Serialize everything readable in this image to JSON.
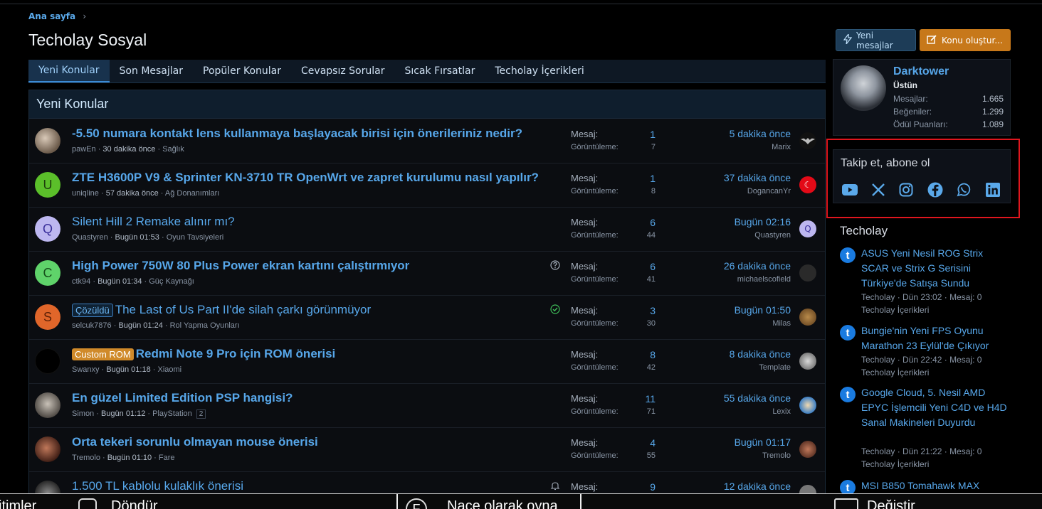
{
  "breadcrumb": {
    "home": "Ana sayfa",
    "sep": "›"
  },
  "page_title": "Techolay Sosyal",
  "actions": {
    "new_messages": "Yeni mesajlar",
    "create_thread": "Konu oluştur..."
  },
  "tabs": [
    "Yeni Konular",
    "Son Mesajlar",
    "Popüler Konular",
    "Cevapsız Sorular",
    "Sıcak Fırsatlar",
    "Techolay İçerikleri"
  ],
  "panel_title": "Yeni Konular",
  "labels": {
    "replies": "Mesaj:",
    "views": "Görüntüleme:"
  },
  "threads": [
    {
      "title": "-5.50 numara kontakt lens kullanmaya başlayacak birisi için önerileriniz nedir?",
      "author": "pawEn",
      "time": "30 dakika önce",
      "forum": "Sağlık",
      "replies": "1",
      "views": "7",
      "last_time": "5 dakika önce",
      "last_user": "Marix",
      "avatar_letter": "",
      "avatar_color": "#6b6b6b",
      "mini_letter": "",
      "mini_color": "#222"
    },
    {
      "title": "ZTE H3600P V9 & Sprinter KN-3710 TR OpenWrt ve zapret kurulumu nasıl yapılır?",
      "author": "uniqline",
      "time": "57 dakika önce",
      "forum": "Ağ Donanımları",
      "replies": "1",
      "views": "8",
      "last_time": "37 dakika önce",
      "last_user": "DogancanYr",
      "avatar_letter": "U",
      "avatar_color": "#5bbf2a",
      "mini_letter": "☾",
      "mini_color": "#e30a17"
    },
    {
      "title": "Silent Hill 2 Remake alınır mı?",
      "author": "Quastyren",
      "time": "Bugün 01:53",
      "forum": "Oyun Tavsiyeleri",
      "replies": "6",
      "views": "44",
      "last_time": "Bugün 02:16",
      "last_user": "Quastyren",
      "avatar_letter": "Q",
      "avatar_color": "#bdb7f0",
      "mini_letter": "Q",
      "mini_color": "#bdb7f0"
    },
    {
      "title": "High Power 750W 80 Plus Power ekran kartını çalıştırmıyor",
      "author": "ctk94",
      "time": "Bugün 01:34",
      "forum": "Güç Kaynağı",
      "replies": "6",
      "views": "41",
      "last_time": "26 dakika önce",
      "last_user": "michaelscofield",
      "avatar_letter": "C",
      "avatar_color": "#5fd36a",
      "mini_letter": "",
      "mini_color": "#333"
    },
    {
      "title": "The Last of Us Part II'de silah çarkı görünmüyor",
      "prefix": "Çözüldü",
      "author": "selcuk7876",
      "time": "Bugün 01:24",
      "forum": "Rol Yapma Oyunları",
      "replies": "3",
      "views": "30",
      "last_time": "Bugün 01:50",
      "last_user": "Milas",
      "avatar_letter": "S",
      "avatar_color": "#e0662a",
      "mini_letter": "",
      "mini_color": "#8a5a2a"
    },
    {
      "title": "Redmi Note 9 Pro için ROM önerisi",
      "prefix": "Custom ROM",
      "author": "Swanxy",
      "time": "Bugün 01:18",
      "forum": "Xiaomi",
      "replies": "8",
      "views": "42",
      "last_time": "8 dakika önce",
      "last_user": "Template",
      "avatar_letter": "",
      "avatar_color": "#000",
      "mini_letter": "",
      "mini_color": "#c9c9c9"
    },
    {
      "title": "En güzel Limited Edition PSP hangisi?",
      "author": "Simon",
      "time": "Bugün 01:12",
      "forum": "PlayStation",
      "pages": "2",
      "replies": "11",
      "views": "71",
      "last_time": "55 dakika önce",
      "last_user": "Lexix",
      "avatar_letter": "",
      "avatar_color": "#8c8c8c",
      "mini_letter": "",
      "mini_color": "#3c7fc4"
    },
    {
      "title": "Orta tekeri sorunlu olmayan mouse önerisi",
      "author": "Tremolo",
      "time": "Bugün 01:10",
      "forum": "Fare",
      "replies": "4",
      "views": "55",
      "last_time": "Bugün 01:17",
      "last_user": "Tremolo",
      "avatar_letter": "",
      "avatar_color": "#7a3b2a",
      "mini_letter": "",
      "mini_color": "#7a3b2a"
    },
    {
      "title": "1.500 TL kablolu kulaklık önerisi",
      "author": "",
      "time": "",
      "forum": "",
      "replies": "9",
      "views": "",
      "last_time": "12 dakika önce",
      "last_user": "",
      "avatar_letter": "",
      "avatar_color": "#444",
      "mini_letter": "",
      "mini_color": "#555"
    }
  ],
  "sidebar": {
    "user": {
      "name": "Darktower",
      "rank": "Üstün",
      "stats": [
        {
          "label": "Mesajlar:",
          "value": "1.665"
        },
        {
          "label": "Beğeniler:",
          "value": "1.299"
        },
        {
          "label": "Ödül Puanları:",
          "value": "1.089"
        }
      ]
    },
    "follow_title": "Takip et, abone ol",
    "social_icons": [
      "youtube-icon",
      "x-icon",
      "instagram-icon",
      "facebook-icon",
      "whatsapp-icon",
      "linkedin-icon"
    ],
    "section_title": "Techolay",
    "news": [
      {
        "title": "ASUS Yeni Nesil ROG Strix SCAR ve Strix G Serisini Türkiye'de Satışa Sundu",
        "meta1": "Techolay · Dün 23:02 · Mesaj: 0",
        "meta2": "Techolay İçerikleri"
      },
      {
        "title": "Bungie'nin Yeni FPS Oyunu Marathon 23 Eylül'de Çıkıyor",
        "meta1": "Techolay · Dün 22:42 · Mesaj: 0",
        "meta2": "Techolay İçerikleri"
      },
      {
        "title": "Google Cloud, 5. Nesil AMD EPYC İşlemcili Yeni C4D ve H4D Sanal Makineleri Duyurdu",
        "meta1": "Techolay · Dün 21:22 · Mesaj: 0",
        "meta2": "Techolay İçerikleri"
      },
      {
        "title": "MSI B850 Tomahawk MAX",
        "meta1": "",
        "meta2": ""
      }
    ]
  },
  "bottom_bar": {
    "item1": "itimler",
    "item2": "Döndür",
    "key2": "F",
    "item3": "Nace olarak oyna",
    "item4": "Değiştir"
  },
  "colors": {
    "accent": "#57a7ea",
    "highlight": "#e0161e",
    "create_button": "#c7781a"
  }
}
